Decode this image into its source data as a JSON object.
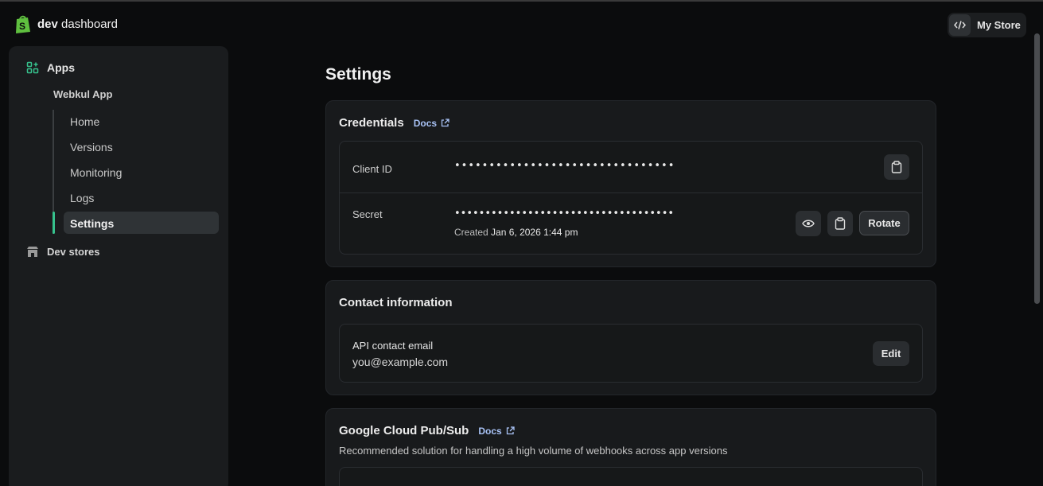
{
  "header": {
    "brand_bold": "dev",
    "brand_rest": " dashboard",
    "store_label": "My Store"
  },
  "sidebar": {
    "apps_label": "Apps",
    "app_name": "Webkul App",
    "items": [
      {
        "label": "Home"
      },
      {
        "label": "Versions"
      },
      {
        "label": "Monitoring"
      },
      {
        "label": "Logs"
      },
      {
        "label": "Settings",
        "active": true
      }
    ],
    "dev_stores_label": "Dev stores"
  },
  "page": {
    "title": "Settings"
  },
  "credentials": {
    "title": "Credentials",
    "docs_label": "Docs",
    "client_id_label": "Client ID",
    "client_id_value": "••••••••••••••••••••••••••••••••",
    "secret_label": "Secret",
    "secret_value": "••••••••••••••••••••••••••••••••••••",
    "created_prefix": "Created",
    "created_date": "Jan 6, 2026 1:44 pm",
    "rotate_label": "Rotate"
  },
  "contact": {
    "title": "Contact information",
    "email_label": "API contact email",
    "email_value": "you@example.com",
    "edit_label": "Edit"
  },
  "pubsub": {
    "title": "Google Cloud Pub/Sub",
    "docs_label": "Docs",
    "description": "Recommended solution for handling a high volume of webhooks across app versions"
  },
  "colors": {
    "accent": "#36c28d",
    "link": "#a8c2f5",
    "background": "#0b0c0d"
  }
}
